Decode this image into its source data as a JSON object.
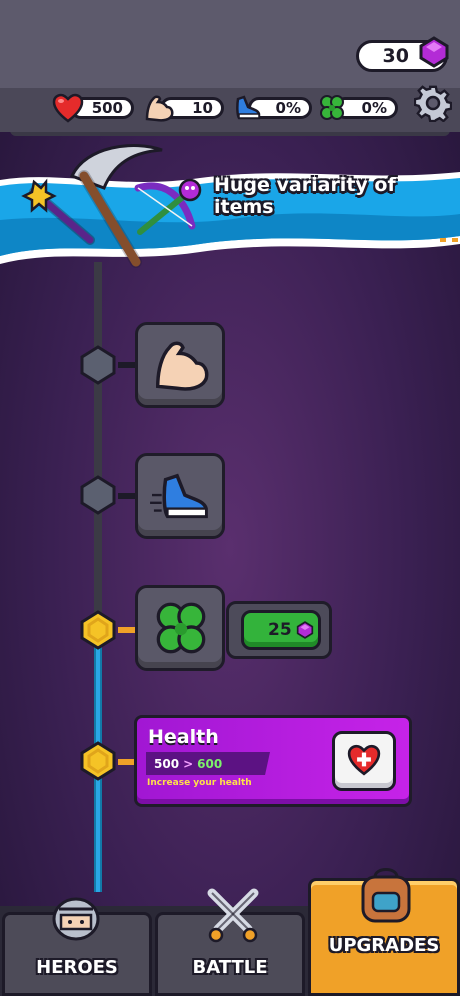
{
  "header": {
    "gems": "30",
    "stats": [
      {
        "icon": "heart-icon",
        "value": "500"
      },
      {
        "icon": "muscle-icon",
        "value": "10"
      },
      {
        "icon": "sneaker-icon",
        "value": "0%"
      },
      {
        "icon": "clover-icon",
        "value": "0%"
      }
    ],
    "settings_icon": "gear-icon"
  },
  "banner": {
    "title": "Huge variarity of items"
  },
  "upgrades": [
    {
      "name": "strength",
      "icon": "muscle-icon",
      "state": "locked"
    },
    {
      "name": "speed",
      "icon": "sneaker-icon",
      "state": "locked"
    },
    {
      "name": "luck",
      "icon": "clover-icon",
      "state": "available",
      "price": "25"
    },
    {
      "name": "health",
      "state": "selected"
    }
  ],
  "health_card": {
    "title": "Health",
    "current": "500",
    "separator": ">",
    "next": "600",
    "description": "Increase your health"
  },
  "nav": {
    "tabs": [
      {
        "label": "HEROES"
      },
      {
        "label": "BATTLE"
      },
      {
        "label": "UPGRADES"
      }
    ]
  },
  "colors": {
    "accent_blue": "#2aa7e6",
    "gold": "#f5c326",
    "purple": "#b61de0",
    "green": "#33b33b",
    "nav_active": "#f0a128"
  }
}
